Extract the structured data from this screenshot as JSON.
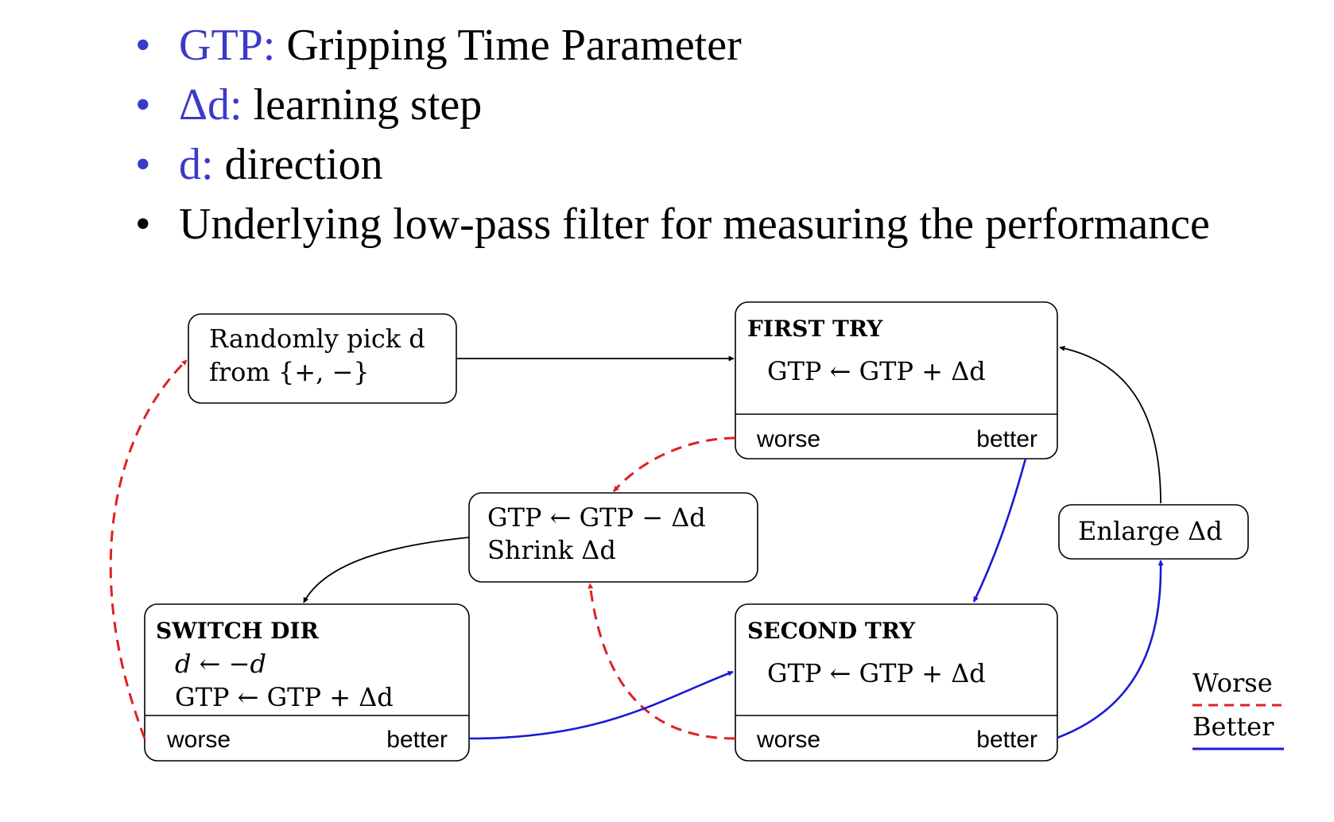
{
  "bullets": [
    {
      "term": "GTP:",
      "text": " Gripping Time Parameter",
      "bullet_color": "#3a3ac8"
    },
    {
      "term": "Δd:",
      "text": " learning step",
      "bullet_color": "#3a3ac8"
    },
    {
      "term": "d:",
      "text": " direction",
      "bullet_color": "#3a3ac8"
    },
    {
      "term": "",
      "text": "Underlying low-pass filter for measuring the performance",
      "bullet_color": "#000000"
    }
  ],
  "bullet_symbol": "•",
  "diagram": {
    "random_pick": {
      "line1": "Randomly pick d",
      "line2": "from {+, −}"
    },
    "first_try": {
      "title": "FIRST TRY",
      "update": "GTP ← GTP + Δd",
      "worse": "worse",
      "better": "better"
    },
    "undo_shrink": {
      "line1": "GTP ← GTP − Δd",
      "line2": "Shrink Δd"
    },
    "enlarge": {
      "label": "Enlarge Δd"
    },
    "switch_dir": {
      "title": "SWITCH DIR",
      "line1": "d ← −d",
      "line2": "GTP ← GTP + Δd",
      "worse": "worse",
      "better": "better"
    },
    "second_try": {
      "title": "SECOND TRY",
      "update": "GTP ← GTP + Δd",
      "worse": "worse",
      "better": "better"
    },
    "legend": {
      "worse": "Worse",
      "better": "Better"
    }
  },
  "colors": {
    "worse": "#e02020",
    "better": "#1a1ad6",
    "term": "#3a3ac8",
    "neutral": "#000000"
  }
}
